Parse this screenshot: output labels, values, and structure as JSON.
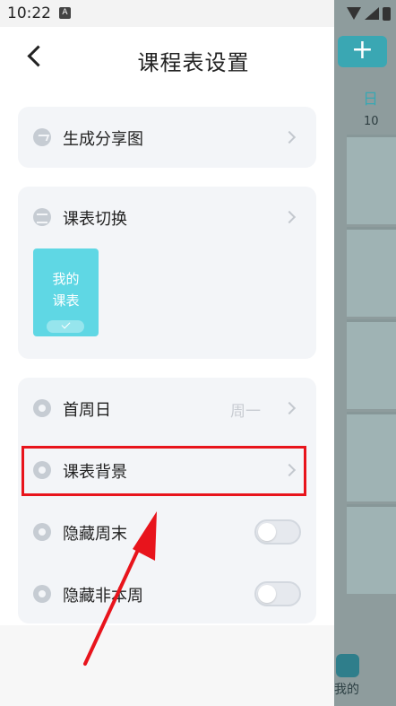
{
  "status_bar": {
    "time": "10:22",
    "notif_icon_letter": "A"
  },
  "header": {
    "title": "课程表设置"
  },
  "share_card": {
    "label": "生成分享图"
  },
  "switch_card": {
    "label": "课表切换",
    "thumbnail_line1": "我的",
    "thumbnail_line2": "课表"
  },
  "settings_card": {
    "rows": [
      {
        "label": "首周日",
        "value": "周一"
      },
      {
        "label": "课表背景"
      },
      {
        "label": "隐藏周末",
        "toggle_on": false
      },
      {
        "label": "隐藏非本周",
        "toggle_on": false
      }
    ]
  },
  "background_app": {
    "add_symbol": "+",
    "day_header": "日",
    "date": "10",
    "tab_label": "我的"
  },
  "colors": {
    "accent": "#5fd7e4",
    "highlight": "#e8141c",
    "card_bg": "#f3f5f8"
  },
  "icons": [
    "back-icon",
    "share-icon",
    "switch-icon",
    "checkmark-icon",
    "calendar-icon",
    "background-icon",
    "eye-icon"
  ]
}
